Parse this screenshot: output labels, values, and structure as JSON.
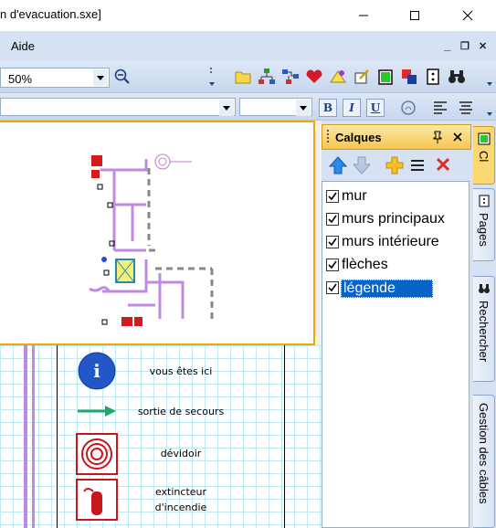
{
  "window": {
    "title": "n d'evacuation.sxe]"
  },
  "menu": {
    "items": [
      "Aide"
    ],
    "mdi_minimize": "_",
    "mdi_restore": "❐",
    "mdi_close": "✕"
  },
  "toolbar": {
    "zoom_value": "50%"
  },
  "format_toolbar": {
    "bold": "B",
    "italic": "I",
    "underline": "U"
  },
  "layers_panel": {
    "title": "Calques",
    "pin": "ɱ",
    "close": "✕",
    "layers": [
      {
        "label": "mur",
        "checked": true,
        "selected": false
      },
      {
        "label": "murs principaux",
        "checked": true,
        "selected": false
      },
      {
        "label": "murs intérieure",
        "checked": true,
        "selected": false
      },
      {
        "label": "flèches",
        "checked": true,
        "selected": false
      },
      {
        "label": "légende",
        "checked": true,
        "selected": true
      }
    ]
  },
  "side_tabs": [
    {
      "label": "Cl",
      "active": true
    },
    {
      "label": "Pages",
      "active": false
    },
    {
      "label": "Rechercher",
      "active": false
    },
    {
      "label": "Gestion des câbles",
      "active": false
    }
  ],
  "legend": [
    {
      "icon": "info-icon",
      "label": "vous êtes ici"
    },
    {
      "icon": "exit-arrow-icon",
      "label": "sortie de secours"
    },
    {
      "icon": "hose-reel-icon",
      "label": "dévidoir"
    },
    {
      "icon": "extinguisher-icon",
      "label": "extincteur\nd'incendie"
    }
  ],
  "colors": {
    "menu_bg": "#d6e1f3",
    "panel_header": "#f6c64f",
    "selection": "#0a64c8",
    "preview_border": "#f2a600",
    "wall": "#c08ae0"
  }
}
